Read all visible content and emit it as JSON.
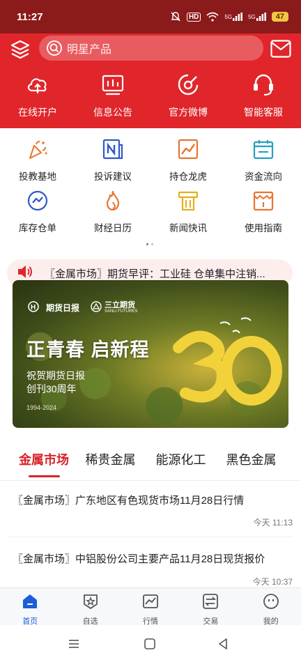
{
  "status": {
    "time": "11:27",
    "battery": "47",
    "hd": "HD",
    "sig1": "5G",
    "sig2": "5G"
  },
  "search": {
    "placeholder": "明星产品"
  },
  "top_shortcuts": [
    {
      "label": "在线开户",
      "icon": "cloud-upload-icon"
    },
    {
      "label": "信息公告",
      "icon": "board-icon"
    },
    {
      "label": "官方微博",
      "icon": "weibo-icon"
    },
    {
      "label": "智能客服",
      "icon": "headset-icon"
    }
  ],
  "grid": [
    {
      "label": "投教基地",
      "icon": "party-popper-icon"
    },
    {
      "label": "投诉建议",
      "icon": "news-n-icon"
    },
    {
      "label": "持仓龙虎",
      "icon": "trend-chart-icon"
    },
    {
      "label": "资金流向",
      "icon": "calendar-flow-icon"
    },
    {
      "label": "库存仓单",
      "icon": "chart-circle-icon"
    },
    {
      "label": "财经日历",
      "icon": "flame-icon"
    },
    {
      "label": "新闻快讯",
      "icon": "news-flash-icon"
    },
    {
      "label": "使用指南",
      "icon": "guide-icon"
    }
  ],
  "notice": {
    "text": "〖金属市场〗期货早评：工业硅 仓单集中注销..."
  },
  "banner": {
    "logo1": "期货日报",
    "logo2": "三立期货",
    "logo2_en": "SANLI FUTURES",
    "headline": "正青春 启新程",
    "sub1": "祝贺期货日报",
    "sub2": "创刊30周年",
    "date": "1994-2024",
    "number": "30"
  },
  "tabs": [
    {
      "label": "金属市场",
      "active": true
    },
    {
      "label": "稀贵金属",
      "active": false
    },
    {
      "label": "能源化工",
      "active": false
    },
    {
      "label": "黑色金属",
      "active": false
    }
  ],
  "news": [
    {
      "title": "〖金属市场〗广东地区有色现货市场11月28日行情",
      "time": "今天 11:13"
    },
    {
      "title": "〖金属市场〗中铝股份公司主要产品11月28日现货报价",
      "time": "今天 10:37"
    }
  ],
  "tabbar": [
    {
      "label": "首页",
      "icon": "home-icon",
      "active": true
    },
    {
      "label": "自选",
      "icon": "star-shield-icon",
      "active": false
    },
    {
      "label": "行情",
      "icon": "market-chart-icon",
      "active": false
    },
    {
      "label": "交易",
      "icon": "exchange-icon",
      "active": false
    },
    {
      "label": "我的",
      "icon": "profile-face-icon",
      "active": false
    }
  ],
  "colors": {
    "brand_red": "#e0262b",
    "status_dark": "#8b1a1a",
    "active_blue": "#1b5ed8",
    "tab_red": "#d8232a"
  }
}
